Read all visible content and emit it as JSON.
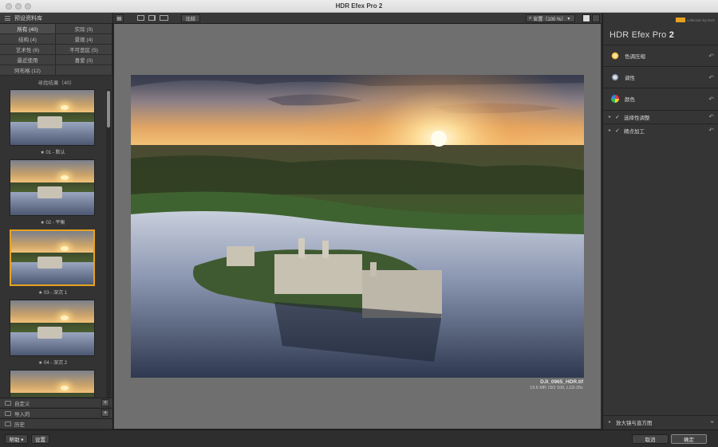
{
  "window": {
    "title": "HDR Efex Pro 2"
  },
  "left_panel": {
    "header_label": "预设资料库",
    "categories": [
      {
        "label": "所有 (40)"
      },
      {
        "label": "实际 (9)"
      },
      {
        "label": "结构 (4)"
      },
      {
        "label": "景观 (4)"
      },
      {
        "label": "艺术性 (6)"
      },
      {
        "label": "不可恶区 (5)"
      },
      {
        "label": "最近使用"
      },
      {
        "label": "喜爱 (0)"
      },
      {
        "label": "阿布格 (12)"
      }
    ],
    "search_results": "寻找结果（40）",
    "presets": [
      {
        "label": "★ 01 - 默认"
      },
      {
        "label": "★ 02 - 平衡"
      },
      {
        "label": "★ 03 - 深沉 1"
      },
      {
        "label": "★ 04 - 深沉 2"
      },
      {
        "label": ""
      }
    ],
    "sections": [
      {
        "label": "自定义"
      },
      {
        "label": "导入的"
      },
      {
        "label": "历史"
      }
    ]
  },
  "toolbar": {
    "compare_label": "比较",
    "zoom_label": "安置（100 %）"
  },
  "image": {
    "filename": "DJI_0965_HDR.tif",
    "info": "19.6 MP, ISO 100, L1D-20c"
  },
  "right_panel": {
    "brand_name": "HDR Efex Pro",
    "brand_version": "2",
    "nik_text": "collection by DxO",
    "filters": [
      {
        "label": "色调压缩",
        "icon": "tone-compression-icon"
      },
      {
        "label": "调性",
        "icon": "tonality-icon"
      },
      {
        "label": "颜色",
        "icon": "color-icon"
      }
    ],
    "sub_sections": [
      {
        "label": "选择性调整"
      },
      {
        "label": "精点加工"
      }
    ],
    "loupe_label": "放大镜与直方图"
  },
  "bottom_bar": {
    "help_label": "帮助 ▾",
    "settings_label": "设置",
    "cancel_label": "取消",
    "ok_label": "确定"
  },
  "colors": {
    "accent": "#e8a21f",
    "panel": "#333333",
    "canvas": "#6f6f6f"
  }
}
